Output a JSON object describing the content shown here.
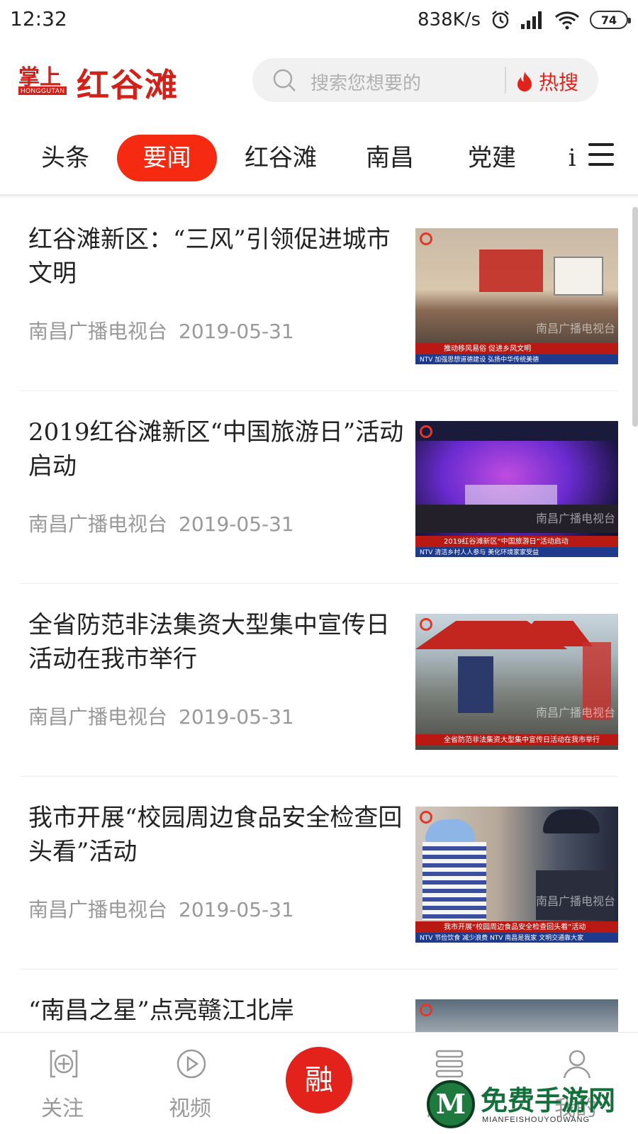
{
  "status_bar": {
    "time": "12:32",
    "speed": "838K/s",
    "battery": "74"
  },
  "header": {
    "logo_small": "掌上",
    "logo_tag": "HONGGUTAN",
    "logo_big": "红谷滩",
    "search_placeholder": "搜索您想要的",
    "hot_label": "热搜"
  },
  "tabs": [
    {
      "label": "头条"
    },
    {
      "label": "要闻",
      "active": true
    },
    {
      "label": "红谷滩"
    },
    {
      "label": "南昌"
    },
    {
      "label": "党建"
    },
    {
      "label": "i"
    }
  ],
  "feed": [
    {
      "title": "红谷滩新区：“三风”引领促进城市文明",
      "source": "南昌广播电视台",
      "date": "2019-05-31",
      "thumb_caption": "推动移风易俗 促进乡风文明",
      "thumb_ticker": "NTV 加强思想道德建设 弘扬中华传统美德",
      "thumb_watermark": "南昌广播电视台"
    },
    {
      "title": "2019红谷滩新区“中国旅游日”活动启动",
      "source": "南昌广播电视台",
      "date": "2019-05-31",
      "thumb_caption": "2019红谷滩新区“中国旅游日”活动启动",
      "thumb_ticker": "NTV 清洁乡村人人参与 美化环境家家受益",
      "thumb_watermark": "南昌广播电视台"
    },
    {
      "title": "全省防范非法集资大型集中宣传日活动在我市举行",
      "source": "南昌广播电视台",
      "date": "2019-05-31",
      "thumb_caption": "全省防范非法集资大型集中宣传日活动在我市举行",
      "thumb_ticker": "",
      "thumb_watermark": "南昌广播电视台"
    },
    {
      "title": "我市开展“校园周边食品安全检查回头看”活动",
      "source": "南昌广播电视台",
      "date": "2019-05-31",
      "thumb_caption": "我市开展“校园周边食品安全检查回头看”活动",
      "thumb_ticker": "NTV 节俭饮食 减少浪费 NTV 南昌是我家 文明交通靠大家",
      "thumb_watermark": "南昌广播电视台"
    },
    {
      "title": "“南昌之星”点亮赣江北岸",
      "source": "",
      "date": "",
      "thumb_caption": "",
      "thumb_ticker": "",
      "thumb_watermark": ""
    }
  ],
  "bottom_nav": {
    "follow": "关注",
    "video": "视频",
    "rong": "融",
    "service": "服务",
    "mine": "我的"
  },
  "watermark": {
    "mark": "M",
    "title": "免费手游网",
    "subtitle": "MIANFEISHOUYOUWANG"
  },
  "colors": {
    "brand_red": "#e3231b",
    "active_tab": "#f52a10",
    "meta_gray": "#999999"
  }
}
